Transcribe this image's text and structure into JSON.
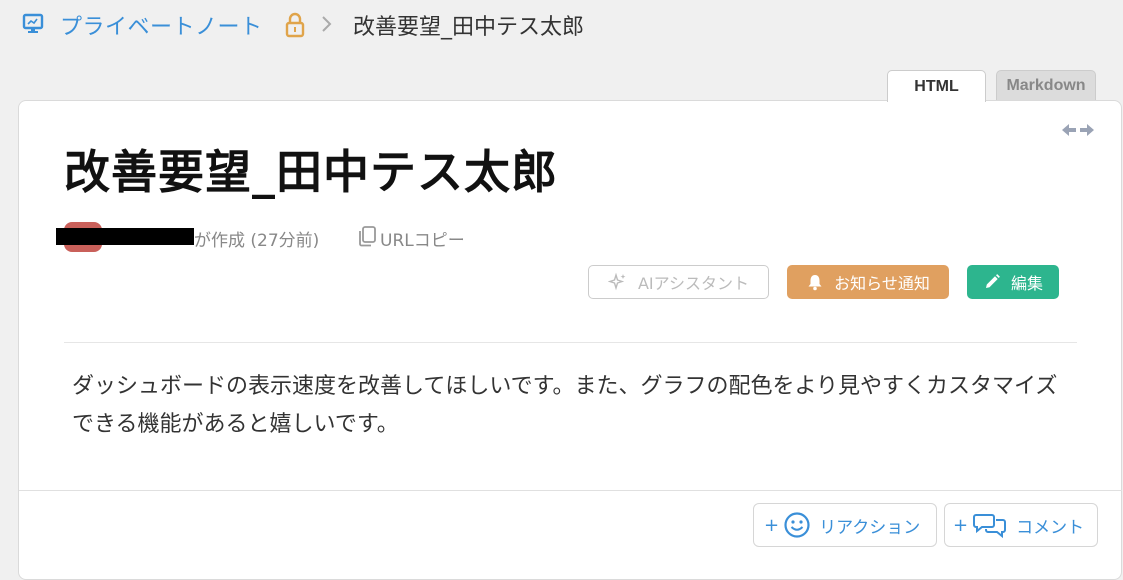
{
  "breadcrumb": {
    "parent_label": "プライベートノート",
    "current_label": "改善要望_田中テス太郎"
  },
  "tabs": {
    "html_label": "HTML",
    "markdown_label": "Markdown"
  },
  "note": {
    "title": "改善要望_田中テス太郎",
    "author_created_text": "が作成 (27分前)",
    "copy_url_label": "URLコピー",
    "body": "ダッシュボードの表示速度を改善してほしいです。また、グラフの配色をより見やすくカスタマイズできる機能があると嬉しいです。"
  },
  "actions": {
    "ai_assistant_label": "AIアシスタント",
    "notify_label": "お知らせ通知",
    "edit_label": "編集"
  },
  "footer": {
    "reaction_label": "リアクション",
    "comment_label": "コメント",
    "plus": "+"
  },
  "colors": {
    "link_blue": "#3a8fd8",
    "notify_orange": "#e0a060",
    "edit_green": "#2db58e",
    "avatar_red": "#c9605a"
  },
  "icons": [
    "computer-icon",
    "lock-icon",
    "chevron-right-icon",
    "expand-horizontal-icon",
    "copy-icon",
    "sparkle-icon",
    "bell-icon",
    "pencil-icon",
    "smiley-icon",
    "comments-icon"
  ]
}
